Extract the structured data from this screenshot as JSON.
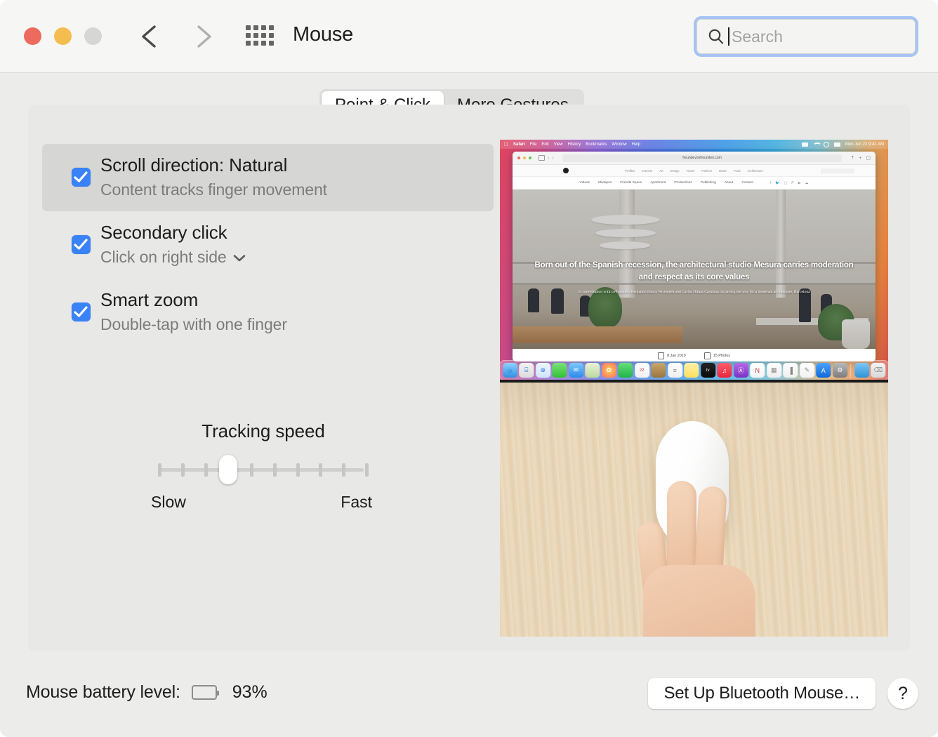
{
  "window": {
    "title": "Mouse",
    "traffic_lights": [
      "close",
      "minimize",
      "zoom"
    ],
    "back_label": "Back",
    "forward_label": "Forward",
    "grid_label": "Show All"
  },
  "search": {
    "placeholder": "Search",
    "value": "",
    "icon": "search-icon"
  },
  "tabs": [
    {
      "label": "Point & Click",
      "active": true
    },
    {
      "label": "More Gestures",
      "active": false
    }
  ],
  "options": [
    {
      "title": "Scroll direction: Natural",
      "subtitle": "Content tracks finger movement",
      "checked": true,
      "selected": true,
      "has_dropdown": false
    },
    {
      "title": "Secondary click",
      "subtitle": "Click on right side",
      "checked": true,
      "selected": false,
      "has_dropdown": true
    },
    {
      "title": "Smart zoom",
      "subtitle": "Double-tap with one finger",
      "checked": true,
      "selected": false,
      "has_dropdown": false
    }
  ],
  "slider": {
    "label": "Tracking speed",
    "min_label": "Slow",
    "max_label": "Fast",
    "ticks": 10,
    "value_index": 3
  },
  "preview": {
    "desktop": {
      "menubar": {
        "apple": "",
        "items": [
          "Safari",
          "File",
          "Edit",
          "View",
          "History",
          "Bookmarks",
          "Window",
          "Help"
        ],
        "status_icons": [
          "battery-icon",
          "wifi-icon",
          "search-icon",
          "control-center-icon"
        ],
        "clock": "Mon Jun 22  9:41 AM"
      },
      "safari": {
        "url": "freundevonfreunden.com",
        "nav_row1": [
          "Profiles",
          "Interiors",
          "Art",
          "Design",
          "Travel",
          "Fashion",
          "Music",
          "Food",
          "Architecture"
        ],
        "nav_row2": [
          "Videos",
          "Mixtapes",
          "Friends Space",
          "Apartment",
          "Productions",
          "Publishing",
          "About",
          "Contact"
        ],
        "headline": "Born out of the Spanish recession, the architectural studio Mesura carries moderation and respect as its core values",
        "subhead": "In conversation with co-founders Benjamin Iborra Wicksteed and Carlos Dimas Carmona on paving the way for a moderate architecture, Barcelona",
        "meta_date": "8 Jan 2019",
        "meta_photos": "15 Photos"
      },
      "dock": [
        "Finder",
        "Launchpad",
        "Safari",
        "Messages",
        "Mail",
        "Maps",
        "Photos",
        "FaceTime",
        "Calendar",
        "Contacts",
        "Reminders",
        "Notes",
        "Apple TV",
        "Music",
        "Podcasts",
        "News",
        "Keynote",
        "Numbers",
        "Pages",
        "App Store",
        "System Preferences",
        "Downloads",
        "Trash"
      ]
    },
    "photo_caption": "Hand resting on a white Magic Mouse on a wooden desk"
  },
  "footer": {
    "battery_label": "Mouse battery level:",
    "battery_percent": "93%",
    "setup_button": "Set Up Bluetooth Mouse…",
    "help_button": "?"
  },
  "colors": {
    "accent": "#3a82f7",
    "focus_ring": "#a6c3f3",
    "panel_bg": "#e8e8e6",
    "selected_row": "#d6d6d4",
    "titlebar_bg": "#f6f6f4"
  }
}
